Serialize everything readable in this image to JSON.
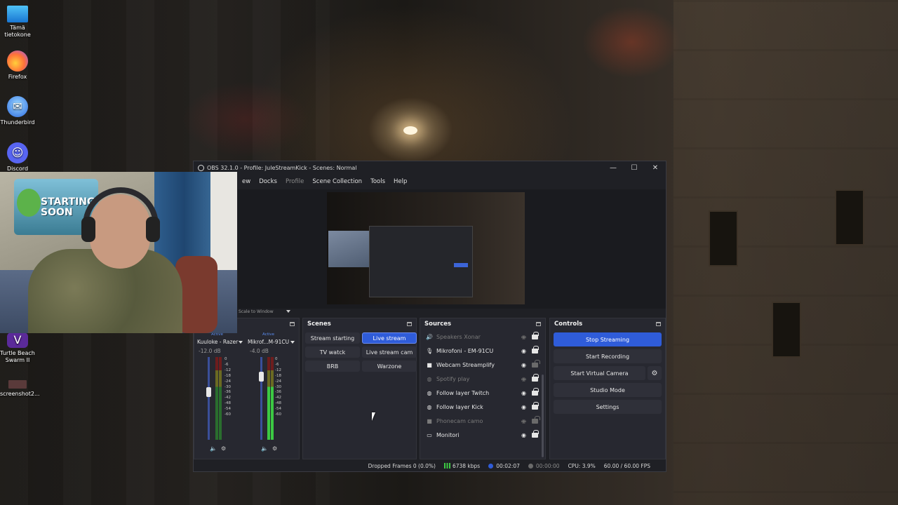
{
  "desktop": {
    "icons": [
      {
        "label": "Tämä tietokone",
        "icon": "monitor-icon"
      },
      {
        "label": "Firefox",
        "icon": "firefox-icon"
      },
      {
        "label": "Thunderbird",
        "icon": "thunderbird-icon"
      },
      {
        "label": "Discord",
        "icon": "discord-icon"
      },
      {
        "label": "Turtle Beach Swarm II",
        "icon": "turtle-beach-icon"
      },
      {
        "label": "screenshot2...",
        "icon": "screenshot-file-icon"
      }
    ]
  },
  "webcam": {
    "poster_text": "STARTING SOON"
  },
  "obs": {
    "title": "OBS 32.1.0 - Profile: JuleStreamKick - Scenes: Normal",
    "window_controls": {
      "minimize": "—",
      "maximize": "☐",
      "close": "✕"
    },
    "menu": [
      "ew",
      "Docks",
      "Profile",
      "Scene Collection",
      "Tools",
      "Help"
    ],
    "preview": {
      "scale_label": "Scale to Window"
    },
    "mixer": {
      "channels": [
        {
          "active": "Active",
          "name": "Kuuloke - Razer",
          "db": "-12.0 dB",
          "level": 0.6
        },
        {
          "active": "Active",
          "name": "Mikrof...M-91CU",
          "db": "-4.0 dB",
          "level": 0.85
        }
      ],
      "scale": [
        "0",
        "-6",
        "-12",
        "-18",
        "-24",
        "-30",
        "-36",
        "-42",
        "-48",
        "-54",
        "-60"
      ]
    },
    "scenes": {
      "title": "Scenes",
      "items": [
        {
          "label": "Stream starting",
          "active": false
        },
        {
          "label": "Live stream",
          "active": true
        },
        {
          "label": "TV watck",
          "active": false
        },
        {
          "label": "Live stream cam",
          "active": false
        },
        {
          "label": "BRB",
          "active": false
        },
        {
          "label": "Warzone",
          "active": false
        }
      ]
    },
    "sources": {
      "title": "Sources",
      "items": [
        {
          "label": "Speakers Xonar",
          "icon": "speaker-icon",
          "visible": false,
          "locked": true,
          "dim": true
        },
        {
          "label": "Mikrofoni - EM-91CU",
          "icon": "microphone-icon",
          "visible": true,
          "locked": true,
          "dim": false
        },
        {
          "label": "Webcam Streamplify",
          "icon": "camera-icon",
          "visible": true,
          "locked": false,
          "dim": false
        },
        {
          "label": "Spotify play",
          "icon": "globe-icon",
          "visible": false,
          "locked": true,
          "dim": true
        },
        {
          "label": "Follow layer Twitch",
          "icon": "globe-icon",
          "visible": true,
          "locked": true,
          "dim": false
        },
        {
          "label": "Follow layer Kick",
          "icon": "globe-icon",
          "visible": true,
          "locked": true,
          "dim": false
        },
        {
          "label": "Phonecam camo",
          "icon": "camera-icon",
          "visible": false,
          "locked": false,
          "dim": true
        },
        {
          "label": "Monitori",
          "icon": "display-icon",
          "visible": true,
          "locked": true,
          "dim": false
        }
      ]
    },
    "controls": {
      "title": "Controls",
      "stop_streaming": "Stop Streaming",
      "start_recording": "Start Recording",
      "start_virtual_camera": "Start Virtual Camera",
      "studio_mode": "Studio Mode",
      "settings": "Settings"
    },
    "status": {
      "dropped_frames": "Dropped Frames 0 (0.0%)",
      "bitrate": "6738 kbps",
      "stream_time": "00:02:07",
      "record_time": "00:00:00",
      "cpu": "CPU: 3.9%",
      "fps": "60.00 / 60.00 FPS"
    },
    "colors": {
      "accent": "#2f5cd9",
      "panel": "#272830",
      "live_green": "#3cc943"
    }
  }
}
